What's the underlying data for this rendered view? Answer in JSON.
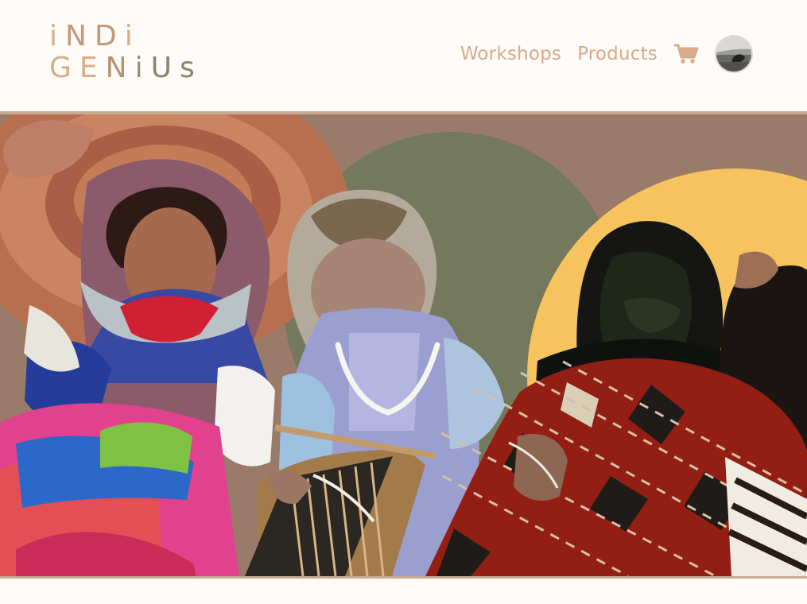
{
  "brand": {
    "logo_line1": [
      "i",
      "N",
      "D",
      "i"
    ],
    "logo_line2": [
      "G",
      "E",
      "N",
      "i",
      "U",
      "s"
    ]
  },
  "nav": {
    "workshops_label": "Workshops",
    "products_label": "Products"
  },
  "icons": {
    "cart": "cart-icon",
    "avatar": "avatar"
  },
  "colors": {
    "accent": "#d9a989",
    "hero_background": "#9a7b6a",
    "green_circle": "#74795d",
    "yellow_circle": "#f7c35f"
  }
}
